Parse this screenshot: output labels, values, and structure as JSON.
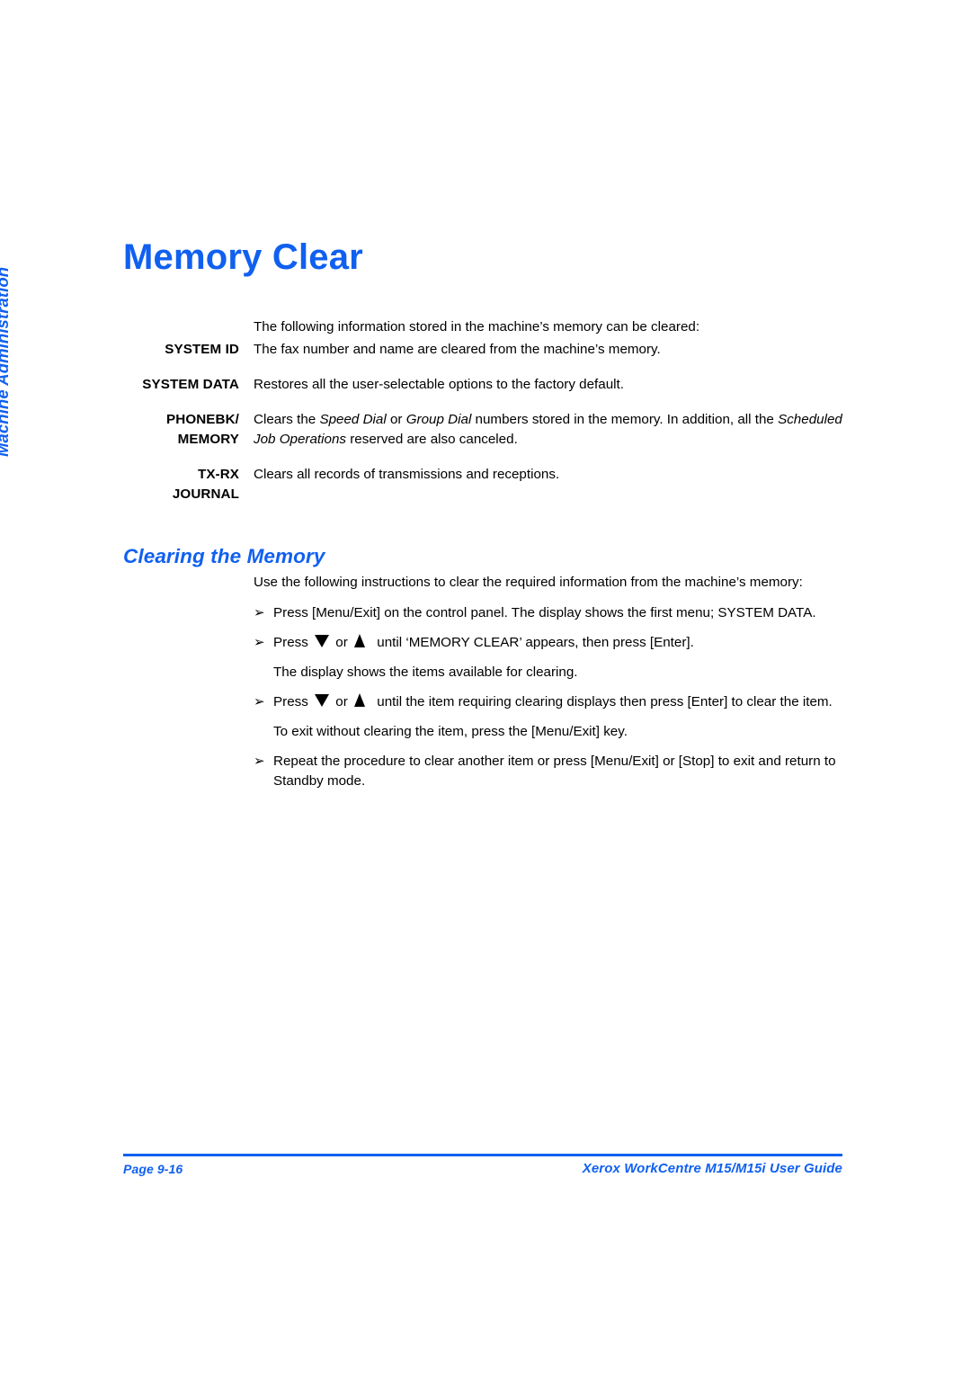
{
  "sidebar": {
    "tab_label": "Machine Administration"
  },
  "chapter": {
    "title": "Memory Clear"
  },
  "intro": {
    "text": "The following information stored in the machine’s memory can be cleared:"
  },
  "definitions": [
    {
      "term": "SYSTEM ID",
      "description": "The fax number and name are cleared from the machine’s memory."
    },
    {
      "term": "SYSTEM DATA",
      "description": "Restores all the user-selectable options to the factory default."
    },
    {
      "term": "PHONEBK/\nMEMORY",
      "description_part1": "Clears the ",
      "description_em1": "Speed Dial",
      "description_part2": " or ",
      "description_em2": "Group Dial",
      "description_part3": " numbers stored in the memory. In addition, all the ",
      "description_em3": "Scheduled Job Operations",
      "description_part4": " reserved are also canceled."
    },
    {
      "term": "TX-RX",
      "term2": "JOURNAL",
      "description": "Clears all records of transmissions and receptions."
    }
  ],
  "section": {
    "title": "Clearing the Memory",
    "lead": "Use the following instructions to clear the required information from the machine’s memory:",
    "bullet_glyph": "➢",
    "steps": [
      {
        "type": "bullet",
        "text": "Press [Menu/Exit] on the control panel. The display shows the first menu; SYSTEM DATA."
      },
      {
        "type": "bullet-with-arrows",
        "text_before": "Press",
        "text_middle": "or",
        "text_after": "until ‘MEMORY CLEAR’ appears, then press [Enter].",
        "icon_down": "down-triangle",
        "icon_up": "up-triangle"
      },
      {
        "type": "plain",
        "text": "The display shows the items available for clearing."
      },
      {
        "type": "bullet-with-arrows",
        "text_before": "Press",
        "text_middle": "or",
        "text_after": "until the item requiring clearing displays then press [Enter] to clear the item.",
        "icon_down": "down-triangle",
        "icon_up": "up-triangle"
      },
      {
        "type": "plain",
        "text": "To exit without clearing the item, press the [Menu/Exit] key."
      },
      {
        "type": "bullet",
        "text": "Repeat the procedure to clear another item or press [Menu/Exit] or [Stop] to exit and return to Standby mode."
      }
    ]
  },
  "footer": {
    "page_label": "Page 9-16",
    "guide_title": "Xerox WorkCentre M15/M15i User Guide"
  },
  "colors": {
    "accent_blue": "#1060f0",
    "body_text": "#000000",
    "page_background": "#ffffff"
  }
}
